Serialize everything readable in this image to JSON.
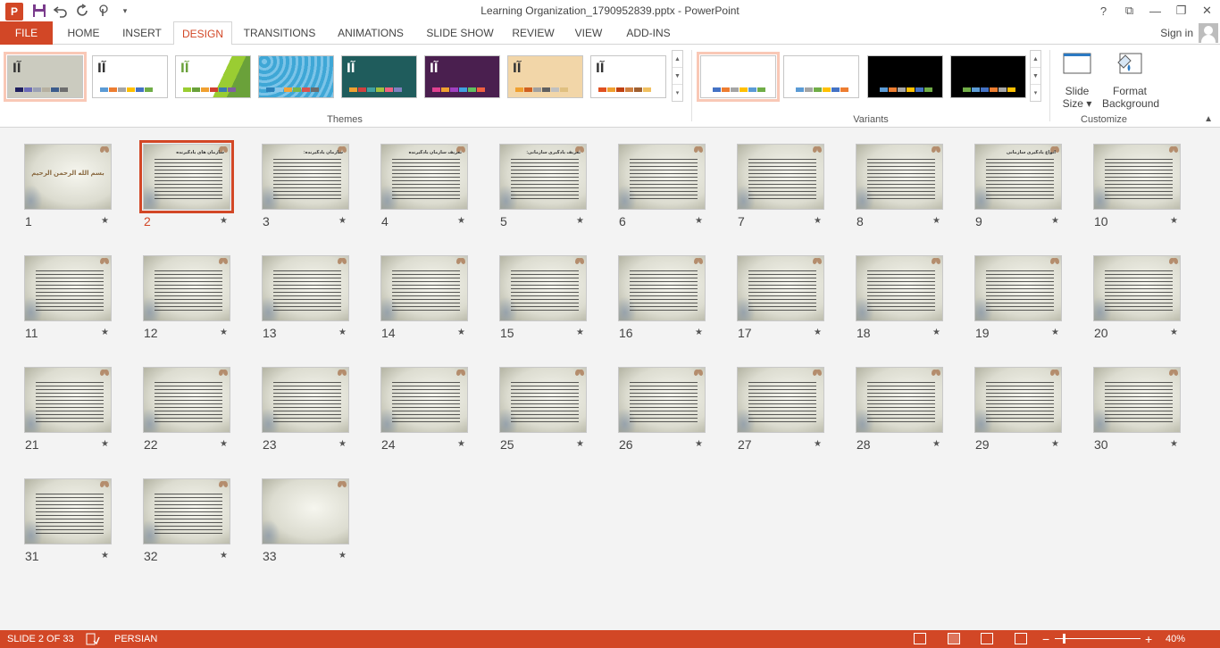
{
  "title_bar": {
    "document_title": "Learning Organization_1790952839.pptx - PowerPoint",
    "qat": [
      "powerpoint-logo",
      "save-icon",
      "undo-icon",
      "redo-icon",
      "touch-mode-icon",
      "customize-qat-icon"
    ],
    "window_controls": {
      "help": "?",
      "ribbon_options": "⧉",
      "minimize": "—",
      "restore": "❐",
      "close": "✕"
    }
  },
  "tabs": [
    "FILE",
    "HOME",
    "INSERT",
    "DESIGN",
    "TRANSITIONS",
    "ANIMATIONS",
    "SLIDE SHOW",
    "REVIEW",
    "VIEW",
    "ADD-INS"
  ],
  "active_tab": "DESIGN",
  "sign_in": "Sign in",
  "ribbon": {
    "themes_label": "Themes",
    "variants_label": "Variants",
    "customize_label": "Customize",
    "themes": [
      {
        "glyph": "آا",
        "bg": "#cbcbbf",
        "fg": "#333333",
        "swatches": [
          "#1f1f5f",
          "#6b6bb8",
          "#9aa0b4",
          "#b6b0a0",
          "#3c5c8c",
          "#6e6e6e"
        ]
      },
      {
        "glyph": "آا",
        "bg": "#ffffff",
        "fg": "#333333",
        "swatches": [
          "#5b9bd5",
          "#ed7d31",
          "#a5a5a5",
          "#ffc000",
          "#4472c4",
          "#70ad47"
        ]
      },
      {
        "glyph": "آا",
        "bg": "#ffffff",
        "fg": "#6aa13a",
        "swatches": [
          "#9acd32",
          "#6aa13a",
          "#f0a030",
          "#d04030",
          "#3a7ab0",
          "#8060a0"
        ]
      },
      {
        "glyph": "",
        "bg": "#3fa7d6",
        "fg": "#ffffff",
        "swatches": [
          "#2a7fb8",
          "#8ac6e8",
          "#f2a33a",
          "#7ab648",
          "#d9534f",
          "#6c6c6c"
        ]
      },
      {
        "glyph": "آا",
        "bg": "#1f5c5c",
        "fg": "#ffffff",
        "swatches": [
          "#f0a030",
          "#d04040",
          "#40a0a0",
          "#a0c040",
          "#f06080",
          "#8080c0"
        ]
      },
      {
        "glyph": "آا",
        "bg": "#4a1f4f",
        "fg": "#ffffff",
        "swatches": [
          "#e04090",
          "#f0a030",
          "#a040c0",
          "#40a0e0",
          "#60c060",
          "#f06040"
        ]
      },
      {
        "glyph": "آا",
        "bg": "#f2d6a8",
        "fg": "#333333",
        "swatches": [
          "#f0a030",
          "#d06020",
          "#a0a0a0",
          "#606060",
          "#c0c0c0",
          "#e0c080"
        ]
      },
      {
        "glyph": "آا",
        "bg": "#ffffff",
        "fg": "#333333",
        "swatches": [
          "#e05020",
          "#f0a030",
          "#c04010",
          "#d08040",
          "#a06030",
          "#f0c060"
        ]
      }
    ],
    "variants": [
      {
        "bg": "#ffffff",
        "swatches": [
          "#4472c4",
          "#ed7d31",
          "#a5a5a5",
          "#ffc000",
          "#5b9bd5",
          "#70ad47"
        ]
      },
      {
        "bg": "#ffffff",
        "swatches": [
          "#5b9bd5",
          "#a5a5a5",
          "#70ad47",
          "#ffc000",
          "#4472c4",
          "#ed7d31"
        ]
      },
      {
        "bg": "#000000",
        "swatches": [
          "#5b9bd5",
          "#ed7d31",
          "#a5a5a5",
          "#ffc000",
          "#4472c4",
          "#70ad47"
        ]
      },
      {
        "bg": "#000000",
        "swatches": [
          "#70ad47",
          "#5b9bd5",
          "#4472c4",
          "#ed7d31",
          "#a5a5a5",
          "#ffc000"
        ]
      }
    ],
    "slide_size": {
      "line1": "Slide",
      "line2": "Size ▾"
    },
    "format_background": {
      "line1": "Format",
      "line2": "Background"
    }
  },
  "slides": [
    {
      "n": "1",
      "title": "",
      "center": "بسم الله الرحمن الرحیم"
    },
    {
      "n": "2",
      "title": "سازمان های یادگیرنده",
      "center": ""
    },
    {
      "n": "3",
      "title": "سازمان یادگیرنده:",
      "center": ""
    },
    {
      "n": "4",
      "title": "تعریف سازمان یادگیرنده",
      "center": ""
    },
    {
      "n": "5",
      "title": "تعریف یادگیری سازمانی:",
      "center": ""
    },
    {
      "n": "6",
      "title": "",
      "center": ""
    },
    {
      "n": "7",
      "title": "",
      "center": ""
    },
    {
      "n": "8",
      "title": "",
      "center": ""
    },
    {
      "n": "9",
      "title": "انواع یادگیری سازمانی",
      "center": ""
    },
    {
      "n": "10",
      "title": "",
      "center": ""
    },
    {
      "n": "11",
      "title": "",
      "center": ""
    },
    {
      "n": "12",
      "title": "",
      "center": ""
    },
    {
      "n": "13",
      "title": "",
      "center": ""
    },
    {
      "n": "14",
      "title": "",
      "center": ""
    },
    {
      "n": "15",
      "title": "",
      "center": ""
    },
    {
      "n": "16",
      "title": "",
      "center": ""
    },
    {
      "n": "17",
      "title": "",
      "center": ""
    },
    {
      "n": "18",
      "title": "",
      "center": ""
    },
    {
      "n": "19",
      "title": "",
      "center": ""
    },
    {
      "n": "20",
      "title": "",
      "center": ""
    },
    {
      "n": "21",
      "title": "",
      "center": ""
    },
    {
      "n": "22",
      "title": "",
      "center": ""
    },
    {
      "n": "23",
      "title": "",
      "center": ""
    },
    {
      "n": "24",
      "title": "",
      "center": ""
    },
    {
      "n": "25",
      "title": "",
      "center": ""
    },
    {
      "n": "26",
      "title": "",
      "center": ""
    },
    {
      "n": "27",
      "title": "",
      "center": ""
    },
    {
      "n": "28",
      "title": "",
      "center": ""
    },
    {
      "n": "29",
      "title": "",
      "center": ""
    },
    {
      "n": "30",
      "title": "",
      "center": ""
    },
    {
      "n": "31",
      "title": "",
      "center": ""
    },
    {
      "n": "32",
      "title": "",
      "center": ""
    },
    {
      "n": "33",
      "title": "",
      "center": ""
    }
  ],
  "selected_slide": "2",
  "status": {
    "slide_info": "SLIDE 2 OF 33",
    "language": "PERSIAN",
    "zoom": "40%",
    "zoom_minus": "−",
    "zoom_plus": "+"
  },
  "colors": {
    "accent": "#d24726"
  }
}
